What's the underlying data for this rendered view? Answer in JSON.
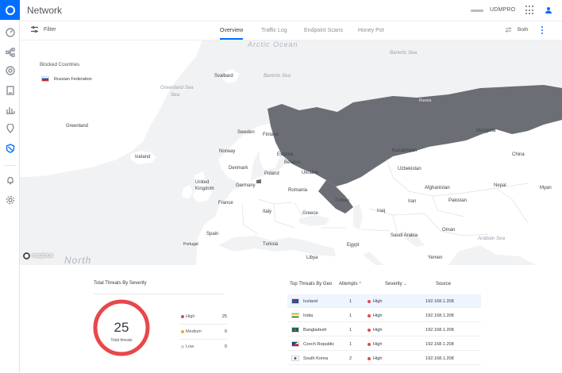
{
  "app": {
    "title": "Network",
    "device_name": "UDMPRO"
  },
  "colors": {
    "accent": "#006fff",
    "high": "#e8474b",
    "medium": "#f2a533",
    "low": "#d0d4d9",
    "blocked_country": "#6c6e76"
  },
  "sidebar": {
    "items": [
      {
        "icon": "dashboard-icon",
        "active": false
      },
      {
        "icon": "topology-icon",
        "active": false
      },
      {
        "icon": "devices-icon",
        "active": false
      },
      {
        "icon": "clients-icon",
        "active": false
      },
      {
        "icon": "statistics-icon",
        "active": false
      },
      {
        "icon": "insights-icon",
        "active": false
      },
      {
        "icon": "threat-management-icon",
        "active": true
      },
      {
        "icon": "alerts-icon",
        "active": false
      },
      {
        "icon": "settings-icon",
        "active": false
      }
    ]
  },
  "subnav": {
    "filter_label": "Filter",
    "tabs": [
      {
        "label": "Overview",
        "active": true
      },
      {
        "label": "Traffic Log",
        "active": false
      },
      {
        "label": "Endpoint Scans",
        "active": false
      },
      {
        "label": "Honey Pot",
        "active": false
      }
    ],
    "direction_label": "Both"
  },
  "map": {
    "blocked_title": "Blocked Countries",
    "blocked_countries": [
      "Russian Federation"
    ],
    "attribution": "mapbox",
    "labels": {
      "arctic": "Arctic Ocean",
      "north": "North",
      "greenland_sea": "Greenland Sea",
      "barents_sea": "Barents Sea",
      "barents_sea_2": "Barents Sea",
      "svalbard": "Svalbard",
      "greenland": "Greenland",
      "iceland": "Iceland",
      "russia": "Russia",
      "sweden": "Sweden",
      "finland": "Finland",
      "norway": "Norway",
      "denmark": "Denmark",
      "estonia": "Estonia",
      "belarus": "Belarus",
      "poland": "Poland",
      "ukraine": "Ukraine",
      "uk": "United Kingdom",
      "germany": "Germany",
      "romania": "Romania",
      "france": "France",
      "italy": "Italy",
      "greece": "Greece",
      "turkey": "Turkey",
      "spain": "Spain",
      "portugal": "Portugal",
      "tunisia": "Tunisia",
      "libya": "Libya",
      "egypt": "Egypt",
      "iraq": "Iraq",
      "iran": "Iran",
      "saudi": "Saudi Arabia",
      "oman": "Oman",
      "yemen": "Yemen",
      "arabian_sea": "Arabian Sea",
      "kazakhstan": "Kazakhstan",
      "uzbekistan": "Uzbekistan",
      "mongolia": "Mongolia",
      "china": "China",
      "afghanistan": "Afghanistan",
      "pakistan": "Pakistan",
      "nepal": "Nepal",
      "myanmar": "Myan"
    }
  },
  "severity": {
    "title": "Total Threats By Severity",
    "total": "25",
    "total_label": "Total threats",
    "rows": [
      {
        "name": "High",
        "value": "25"
      },
      {
        "name": "Medium",
        "value": "0"
      },
      {
        "name": "Low",
        "value": "0"
      }
    ]
  },
  "geo": {
    "title": "Top Threats By Geo",
    "col_attempts": "Attempts",
    "col_severity": "Severity",
    "col_source": "Source",
    "rows": [
      {
        "country": "Iceland",
        "attempts": "1",
        "severity": "High",
        "source": "192.168.1.208"
      },
      {
        "country": "India",
        "attempts": "1",
        "severity": "High",
        "source": "192.168.1.208"
      },
      {
        "country": "Bangladesh",
        "attempts": "1",
        "severity": "High",
        "source": "192.168.1.208"
      },
      {
        "country": "Czech Republic",
        "attempts": "1",
        "severity": "High",
        "source": "192.168.1.208"
      },
      {
        "country": "South Korea",
        "attempts": "2",
        "severity": "High",
        "source": "192.168.1.208"
      }
    ]
  }
}
